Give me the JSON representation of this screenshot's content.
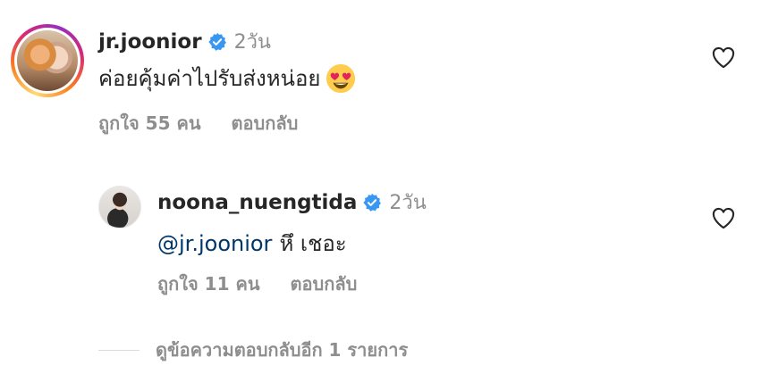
{
  "comment1": {
    "username": "jr.joonior",
    "time": "2วัน",
    "text": "ค่อยคุ้มค่าไปรับส่งหน่อย",
    "likes": "ถูกใจ 55 คน",
    "reply": "ตอบกลับ"
  },
  "comment2": {
    "username": "noona_nuengtida",
    "time": "2วัน",
    "mention": "@jr.joonior",
    "text": "หึ เชอะ",
    "likes": "ถูกใจ 11 คน",
    "reply": "ตอบกลับ"
  },
  "view_replies": "ดูข้อความตอบกลับอีก 1 รายการ",
  "icons": {
    "verified": "verified-badge-icon",
    "heart": "heart-outline-icon",
    "emoji": "heart-eyes-emoji"
  },
  "colors": {
    "verified": "#3897f0",
    "mention": "#00376b",
    "secondary_text": "#8e8e8e"
  }
}
